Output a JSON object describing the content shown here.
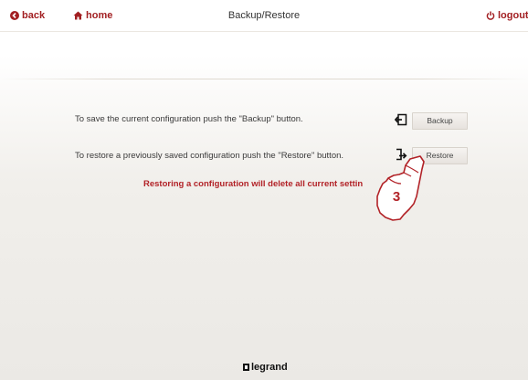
{
  "header": {
    "back_label": "back",
    "home_label": "home",
    "title": "Backup/Restore",
    "logout_label": "logout"
  },
  "content": {
    "backup_text": "To save the current configuration push the \"Backup\" button.",
    "backup_button": "Backup",
    "restore_text": "To restore a previously saved configuration push the \"Restore\" button.",
    "restore_button": "Restore",
    "warning": "Restoring a configuration will delete all current settin"
  },
  "callout": {
    "step_number": "3"
  },
  "footer": {
    "logo_text": "legrand"
  },
  "colors": {
    "accent": "#a21f22",
    "warning": "#b22227"
  }
}
